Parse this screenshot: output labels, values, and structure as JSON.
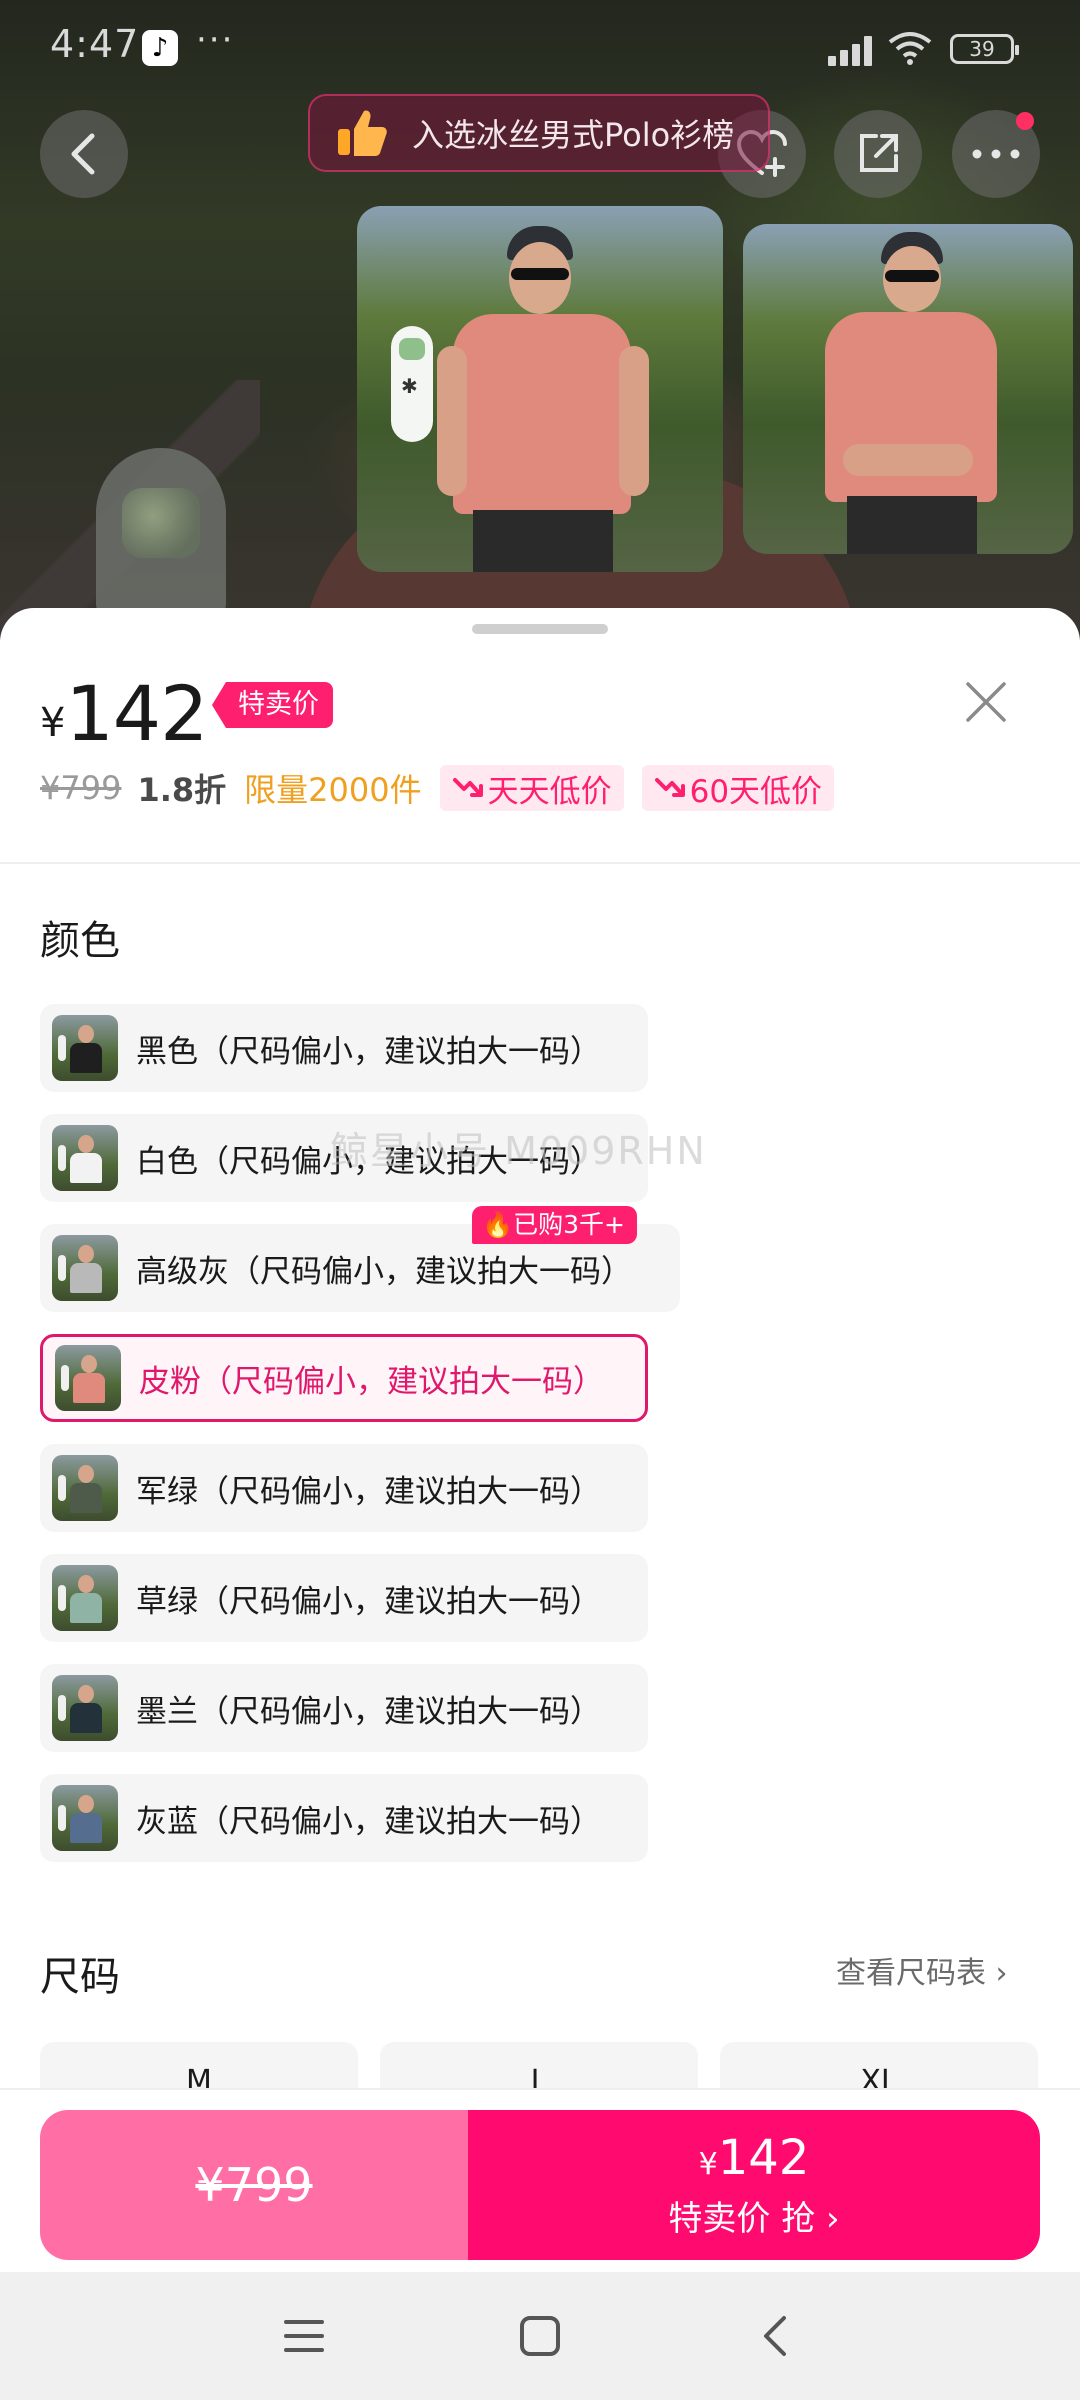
{
  "status_bar": {
    "time": "4:47",
    "dots": "···",
    "battery": "39"
  },
  "header": {
    "rank_banner": "入选冰丝男式Polo衫榜"
  },
  "price": {
    "currency": "¥",
    "current": "142",
    "tag": "特卖价",
    "original": "¥799",
    "discount": "1.8折",
    "limited": "限量2000件",
    "pills": [
      "天天低价",
      "60天低价"
    ]
  },
  "colors": {
    "title": "颜色",
    "hot_badge": "已购3千+",
    "selected_index": 3,
    "items": [
      {
        "label": "黑色（尺码偏小，建议拍大一码）",
        "swatch": "#1f1f1f"
      },
      {
        "label": "白色（尺码偏小，建议拍大一码）",
        "swatch": "#f2f2f2"
      },
      {
        "label": "高级灰（尺码偏小，建议拍大一码）",
        "swatch": "#b9b9b9"
      },
      {
        "label": "皮粉（尺码偏小，建议拍大一码）",
        "swatch": "#e08a7e"
      },
      {
        "label": "军绿（尺码偏小，建议拍大一码）",
        "swatch": "#4f5b4a"
      },
      {
        "label": "草绿（尺码偏小，建议拍大一码）",
        "swatch": "#8fb4a6"
      },
      {
        "label": "墨兰（尺码偏小，建议拍大一码）",
        "swatch": "#23313a"
      },
      {
        "label": "灰蓝（尺码偏小，建议拍大一码）",
        "swatch": "#556d8e"
      }
    ]
  },
  "sizes": {
    "title": "尺码",
    "chart_link": "查看尺码表 ›",
    "items": [
      "M",
      "L",
      "XL"
    ]
  },
  "watermark": "鲸星小号 M009RHN",
  "bottom_bar": {
    "original_price": "¥799",
    "special_currency": "¥",
    "special_price": "142",
    "special_text": "特卖价 抢 ›"
  },
  "theme": {
    "accent": "#ff0a6e",
    "accent_light": "#ff6fa6",
    "orange": "#f0a020"
  }
}
